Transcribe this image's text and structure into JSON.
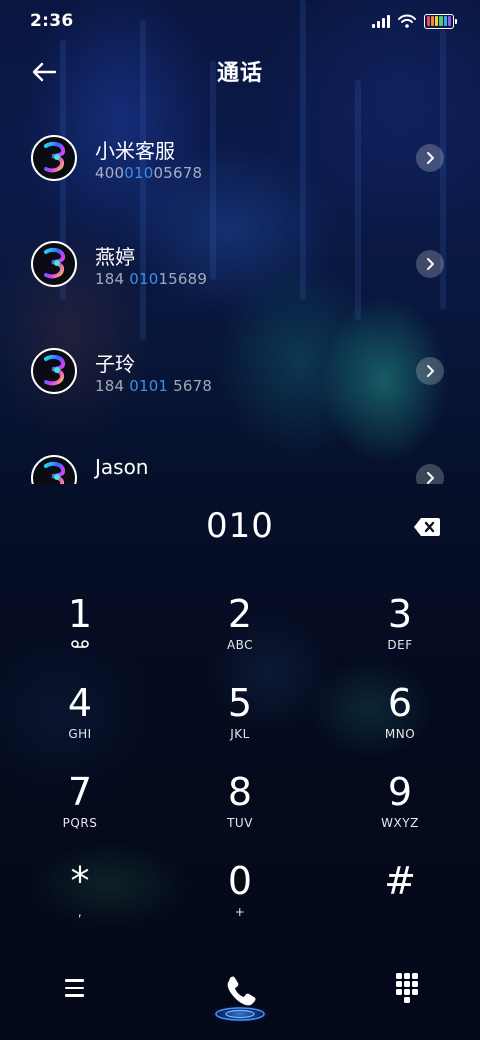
{
  "status_bar": {
    "time": "2:36",
    "signal_icon": "signal-bars-icon",
    "wifi_icon": "wifi-icon",
    "battery_icon": "battery-icon",
    "battery_colors": [
      "#e94b5b",
      "#f08a3c",
      "#f4d03f",
      "#5ccc6c",
      "#3fa9f5",
      "#8a63e6"
    ]
  },
  "header": {
    "back_icon": "back-arrow-icon",
    "title": "通话"
  },
  "contacts": [
    {
      "name": "小米客服",
      "number_parts": [
        "400",
        "010",
        "05678"
      ],
      "highlight_index": 1
    },
    {
      "name": "燕婷",
      "number_parts": [
        "184 ",
        "010",
        "15689"
      ],
      "highlight_index": 1
    },
    {
      "name": "子玲",
      "number_parts": [
        "184 ",
        "0101",
        " 5678"
      ],
      "highlight_index": 1
    },
    {
      "name": "Jason",
      "number_parts": [
        "",
        "",
        ""
      ],
      "highlight_index": 1
    }
  ],
  "contact_detail_icon": "chevron-right-icon",
  "dialer": {
    "input": "010",
    "backspace_icon": "backspace-icon",
    "keys": [
      {
        "digit": "1",
        "letters": "",
        "sub_icon": "voicemail-icon"
      },
      {
        "digit": "2",
        "letters": "ABC"
      },
      {
        "digit": "3",
        "letters": "DEF"
      },
      {
        "digit": "4",
        "letters": "GHI"
      },
      {
        "digit": "5",
        "letters": "JKL"
      },
      {
        "digit": "6",
        "letters": "MNO"
      },
      {
        "digit": "7",
        "letters": "PQRS"
      },
      {
        "digit": "8",
        "letters": "TUV"
      },
      {
        "digit": "9",
        "letters": "WXYZ"
      },
      {
        "digit": "*",
        "letters": ","
      },
      {
        "digit": "0",
        "letters": "+"
      },
      {
        "digit": "#",
        "letters": ""
      }
    ]
  },
  "bottom_bar": {
    "menu_icon": "menu-icon",
    "call_icon": "phone-call-icon",
    "keypad_icon": "dialpad-icon",
    "accent": "#2f7fff"
  }
}
